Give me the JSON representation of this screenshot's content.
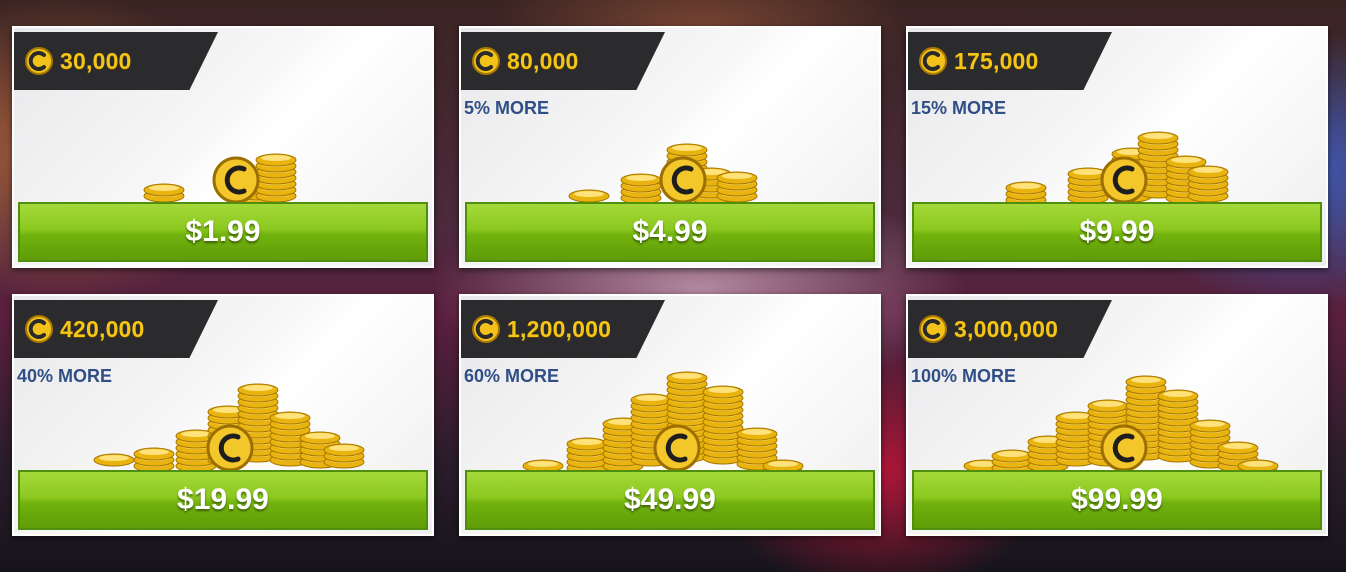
{
  "currency_icon": "c-coin-icon",
  "colors": {
    "amount_text": "#f5c518",
    "bonus_text": "#2f4f86",
    "button_green": "#7dbd14",
    "ribbon": "#2b2b2d"
  },
  "packs": [
    {
      "amount": "30,000",
      "bonus": "",
      "price": "$1.99",
      "size": 1
    },
    {
      "amount": "80,000",
      "bonus": "5% MORE",
      "price": "$4.99",
      "size": 2
    },
    {
      "amount": "175,000",
      "bonus": "15% MORE",
      "price": "$9.99",
      "size": 3
    },
    {
      "amount": "420,000",
      "bonus": "40% MORE",
      "price": "$19.99",
      "size": 4
    },
    {
      "amount": "1,200,000",
      "bonus": "60% MORE",
      "price": "$49.99",
      "size": 5
    },
    {
      "amount": "3,000,000",
      "bonus": "100% MORE",
      "price": "$99.99",
      "size": 6
    }
  ]
}
